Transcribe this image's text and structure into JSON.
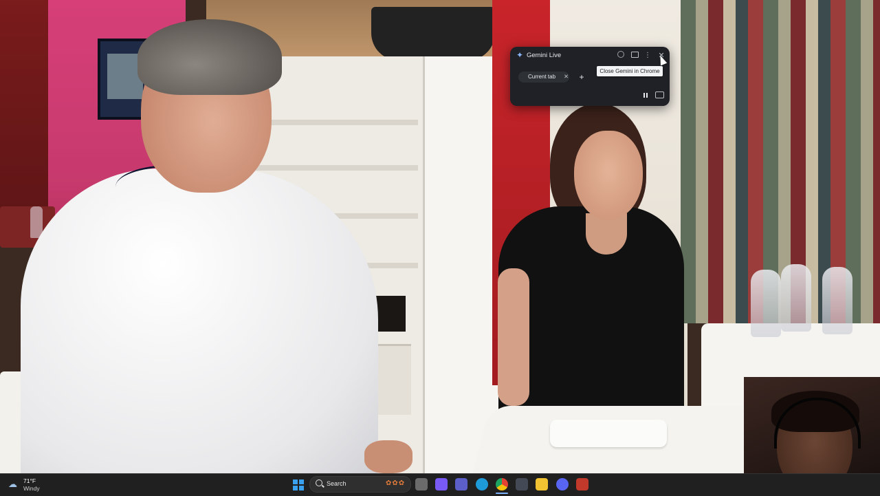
{
  "gemini_live": {
    "title": "Gemini Live",
    "chip_label": "Current tab",
    "add_label": "+",
    "close_tooltip": "Close Gemini in Chrome"
  },
  "icons": {
    "gemini": "sparkle-icon",
    "close": "close-icon",
    "more": "more-vertical-icon",
    "pause": "pause-icon",
    "captions": "captions-icon"
  },
  "taskbar": {
    "weather_temp": "71°F",
    "weather_desc": "Windy",
    "search_placeholder": "Search",
    "apps": [
      {
        "name": "file-explorer-task-icon",
        "color": "#6b6b6b"
      },
      {
        "name": "copilot-icon",
        "color": "#7a5af5"
      },
      {
        "name": "teams-icon",
        "color": "#5b5fc7"
      },
      {
        "name": "edge-icon",
        "color": "#1f9ad8"
      },
      {
        "name": "chrome-icon",
        "color": "#e34133"
      },
      {
        "name": "calculator-icon",
        "color": "#444a55"
      },
      {
        "name": "folder-icon",
        "color": "#f1c232"
      },
      {
        "name": "discord-icon",
        "color": "#5865f2"
      },
      {
        "name": "app-icon",
        "color": "#c0392b"
      }
    ]
  },
  "colors": {
    "panel_bg": "#1f2127",
    "accent_blue": "#8ab4f8",
    "taskbar_bg": "#202020"
  }
}
